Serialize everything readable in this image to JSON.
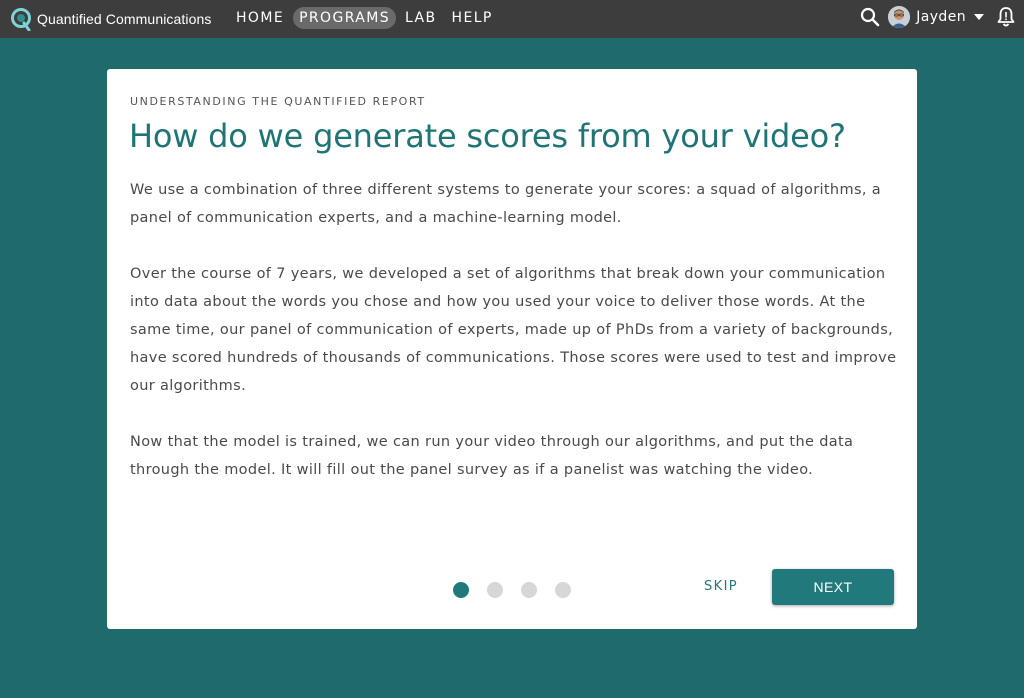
{
  "brand": {
    "name": "Quantified Communications",
    "logo_icon": "q-logo-icon"
  },
  "nav": {
    "items": [
      {
        "label": "HOME",
        "active": false
      },
      {
        "label": "PROGRAMS",
        "active": true
      },
      {
        "label": "LAB",
        "active": false
      },
      {
        "label": "HELP",
        "active": false
      }
    ]
  },
  "user": {
    "name": "Jayden"
  },
  "icons": {
    "search": "search-icon",
    "caret": "caret-down-icon",
    "bell": "bell-alert-icon"
  },
  "card": {
    "eyebrow": "UNDERSTANDING THE QUANTIFIED REPORT",
    "title": "How do we generate scores from your video?",
    "paragraphs": [
      "We use a combination of three different systems to generate your scores: a squad of algorithms, a panel of communication experts, and a machine-learning model.",
      "Over the course of 7 years, we developed a set of algorithms that break down your communication into data about the words you chose and how you used your voice to deliver those words. At the same time, our panel of communication of experts, made up of PhDs from a variety of backgrounds, have scored hundreds of thousands of communications. Those scores were used to test and improve our algorithms.",
      "Now that the model is trained, we can run your video through our algorithms, and put the data through the model. It will fill out the panel survey as if a panelist was watching the video."
    ],
    "pager": {
      "total": 4,
      "current": 1
    },
    "skip_label": "SKIP",
    "next_label": "NEXT"
  },
  "colors": {
    "background": "#1f6b6c",
    "topbar": "#3d3d3d",
    "accent": "#22797b",
    "title": "#1f7476",
    "dot_inactive": "#d7d7d7"
  }
}
